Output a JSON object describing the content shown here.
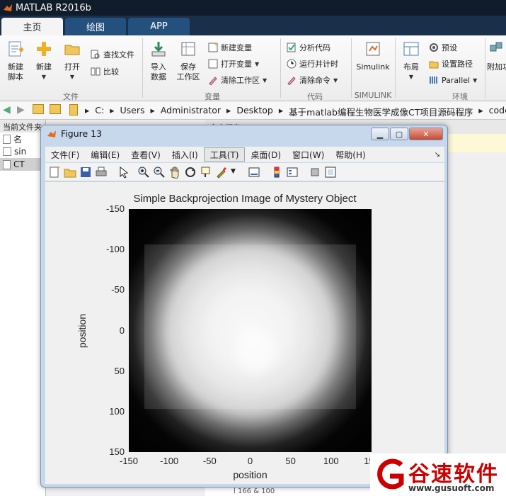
{
  "app": {
    "title": "MATLAB R2016b"
  },
  "tabs": [
    {
      "label": "主页"
    },
    {
      "label": "绘图"
    },
    {
      "label": "APP"
    }
  ],
  "ribbon": {
    "new_script": "新建\n脚本",
    "new": "新建",
    "open": "打开",
    "find_files": "查找文件",
    "compare": "比较",
    "group_file": "文件",
    "import": "导入\n数据",
    "save_ws": "保存\n工作区",
    "new_var": "新建变量",
    "open_var": "打开变量",
    "clear_ws": "清除工作区",
    "group_var": "变量",
    "analyze": "分析代码",
    "run_time": "运行并计时",
    "clear_cmd": "清除命令",
    "group_code": "代码",
    "simulink": "Simulink",
    "group_simulink": "SIMULINK",
    "layout": "布局",
    "prefs": "预设",
    "set_path": "设置路径",
    "parallel": "Parallel",
    "group_env": "环境",
    "addons": "附加功"
  },
  "address": {
    "segments": [
      "C:",
      "Users",
      "Administrator",
      "Desktop",
      "基于matlab编程生物医学成像CT项目源码程序",
      "code"
    ]
  },
  "left_panel": {
    "header": "当前文件夹",
    "col": "名",
    "rows": [
      "sin",
      "CT"
    ]
  },
  "command": {
    "header": "命令行窗口",
    "bottom": "l  166  & 100"
  },
  "figure": {
    "title": "Figure 13",
    "menu": [
      "文件(F)",
      "编辑(E)",
      "查看(V)",
      "插入(I)",
      "工具(T)",
      "桌面(D)",
      "窗口(W)",
      "帮助(H)"
    ]
  },
  "chart_data": {
    "type": "heatmap",
    "title": "Simple Backprojection Image of Mystery Object",
    "xlabel": "position",
    "ylabel": "position",
    "xlim": [
      -150,
      150
    ],
    "ylim": [
      -150,
      150
    ],
    "x_ticks": [
      "-150",
      "-100",
      "-50",
      "0",
      "50",
      "100",
      "150"
    ],
    "y_ticks": [
      "-150",
      "-100",
      "-50",
      "0",
      "50",
      "100",
      "150"
    ],
    "colormap": "gray"
  },
  "watermark": {
    "name": "谷速软件",
    "url": "www.gusuoft.com"
  }
}
